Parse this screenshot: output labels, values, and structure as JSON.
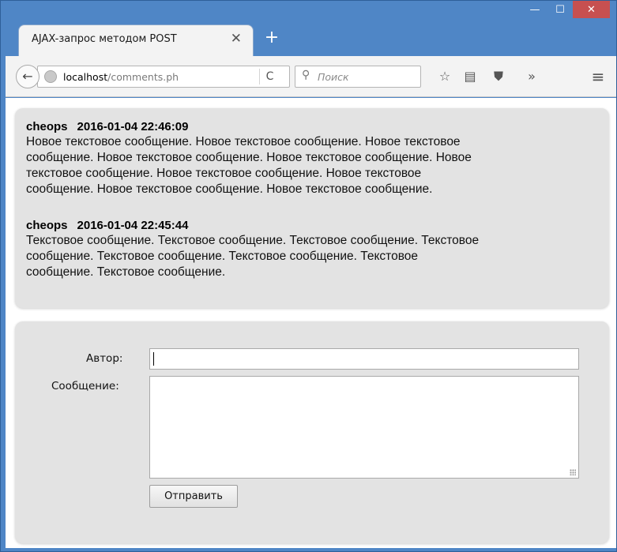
{
  "window": {
    "minimize_glyph": "—",
    "maximize_glyph": "☐",
    "close_glyph": "✕"
  },
  "tab": {
    "title": "AJAX-запрос методом POST",
    "close_glyph": "✕",
    "new_tab_glyph": "+"
  },
  "navbar": {
    "back_glyph": "←",
    "url_host": "localhost",
    "url_path": "/comments.ph",
    "reload_glyph": "C",
    "search_placeholder": "Поиск",
    "search_glyph": "⚲",
    "bookmark_glyph": "☆",
    "reading_list_glyph": "▤",
    "pocket_glyph": "⛊",
    "overflow_glyph": "»",
    "menu_glyph": "≡"
  },
  "comments": [
    {
      "author": "cheops",
      "datetime": "2016-01-04 22:46:09",
      "lines": [
        "Новое текстовое сообщение. Новое текстовое сообщение. Новое текстовое",
        "сообщение. Новое текстовое сообщение. Новое текстовое сообщение. Новое",
        "текстовое сообщение. Новое текстовое сообщение. Новое текстовое",
        "сообщение. Новое текстовое сообщение. Новое текстовое сообщение."
      ]
    },
    {
      "author": "cheops",
      "datetime": "2016-01-04 22:45:44",
      "lines": [
        "Текстовое сообщение. Текстовое сообщение. Текстовое сообщение. Текстовое",
        "сообщение. Текстовое сообщение. Текстовое сообщение. Текстовое",
        "сообщение. Текстовое сообщение."
      ]
    }
  ],
  "form": {
    "author_label": "Автор:",
    "author_value": "",
    "message_label": "Сообщение:",
    "message_value": "",
    "submit_label": "Отправить"
  }
}
